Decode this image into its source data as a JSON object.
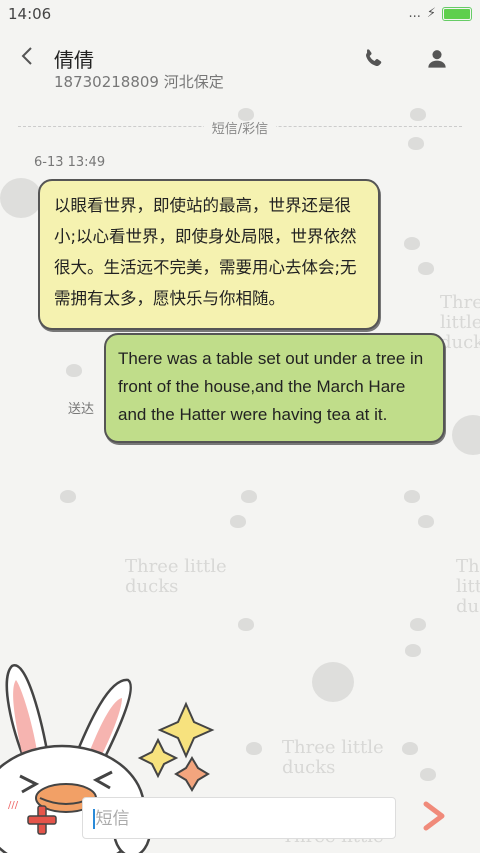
{
  "status_bar": {
    "time": "14:06",
    "dots": "...",
    "charging_icon": "lightning-icon"
  },
  "header": {
    "back_icon": "back-arrow-icon",
    "contact_name": "倩倩",
    "contact_sub": "18730218809 河北保定",
    "phone_icon": "phone-icon",
    "contact_icon": "person-icon"
  },
  "conversation": {
    "divider_label": "短信/彩信",
    "timestamp": "6-13 13:49",
    "messages": [
      {
        "direction": "incoming",
        "text": "以眼看世界，即使站的最高，世界还是很小;以心看世界，即使身处局限，世界依然很大。生活远不完美，需要用心去体会;无需拥有太多，愿快乐与你相随。"
      },
      {
        "direction": "outgoing",
        "text": "There was a table set out under a tree in front of the house,and the March Hare and the Hatter were having tea at it.",
        "status": "送达"
      }
    ]
  },
  "background_text": [
    "Three little ducks",
    "Three little ducks",
    "Three little ducks",
    "Three little ducks",
    "Three little ducks"
  ],
  "composer": {
    "placeholder": "短信",
    "send_icon": "send-arrow-icon",
    "attach_icon": "plus-icon"
  },
  "colors": {
    "incoming_bubble": "#f5f2b0",
    "outgoing_bubble": "#c0dd8a",
    "send_accent": "#f08a7a",
    "battery": "#5fcf4d"
  }
}
